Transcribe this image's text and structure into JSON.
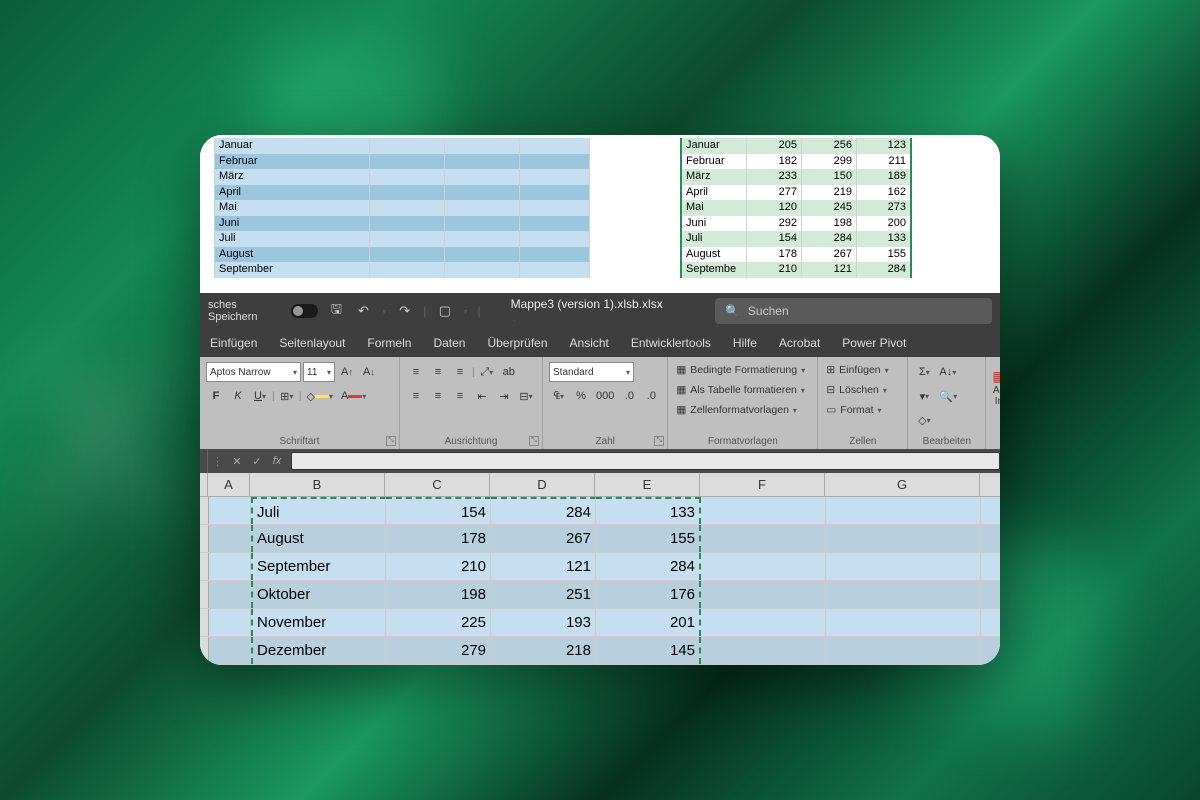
{
  "titlebar": {
    "autosave_label": "sches Speichern",
    "doc_title": "Mappe3 (version 1).xlsb.xlsx",
    "search_placeholder": "Suchen"
  },
  "tabs": [
    "Einfügen",
    "Seitenlayout",
    "Formeln",
    "Daten",
    "Überprüfen",
    "Ansicht",
    "Entwicklertools",
    "Hilfe",
    "Acrobat",
    "Power Pivot"
  ],
  "ribbon": {
    "font_name": "Aptos Narrow",
    "font_size": "11",
    "number_format": "Standard",
    "group_font": "Schriftart",
    "group_align": "Ausrichtung",
    "group_number": "Zahl",
    "group_styles": "Formatvorlagen",
    "group_cells": "Zellen",
    "group_editing": "Bearbeiten",
    "cond_format": "Bedingte Formatierung",
    "as_table": "Als Tabelle formatieren",
    "cell_styles": "Zellenformatvorlagen",
    "insert": "Einfügen",
    "delete": "Löschen",
    "format": "Format",
    "addins": "Ad",
    "addins2": "In"
  },
  "top_left_rows": [
    "Januar",
    "Februar",
    "März",
    "April",
    "Mai",
    "Juni",
    "Juli",
    "August",
    "September"
  ],
  "top_right_rows": [
    {
      "m": "Januar",
      "a": "205",
      "b": "256",
      "c": "123"
    },
    {
      "m": "Februar",
      "a": "182",
      "b": "299",
      "c": "211"
    },
    {
      "m": "März",
      "a": "233",
      "b": "150",
      "c": "189"
    },
    {
      "m": "April",
      "a": "277",
      "b": "219",
      "c": "162"
    },
    {
      "m": "Mai",
      "a": "120",
      "b": "245",
      "c": "273"
    },
    {
      "m": "Juni",
      "a": "292",
      "b": "198",
      "c": "200"
    },
    {
      "m": "Juli",
      "a": "154",
      "b": "284",
      "c": "133"
    },
    {
      "m": "August",
      "a": "178",
      "b": "267",
      "c": "155"
    },
    {
      "m": "Septembe",
      "a": "210",
      "b": "121",
      "c": "284"
    }
  ],
  "columns": [
    "A",
    "B",
    "C",
    "D",
    "E",
    "F",
    "G"
  ],
  "main_rows": [
    {
      "b": "Juli",
      "c": "154",
      "d": "284",
      "e": "133"
    },
    {
      "b": "August",
      "c": "178",
      "d": "267",
      "e": "155"
    },
    {
      "b": "September",
      "c": "210",
      "d": "121",
      "e": "284"
    },
    {
      "b": "Oktober",
      "c": "198",
      "d": "251",
      "e": "176"
    },
    {
      "b": "November",
      "c": "225",
      "d": "193",
      "e": "201"
    },
    {
      "b": "Dezember",
      "c": "279",
      "d": "218",
      "e": "145"
    }
  ]
}
